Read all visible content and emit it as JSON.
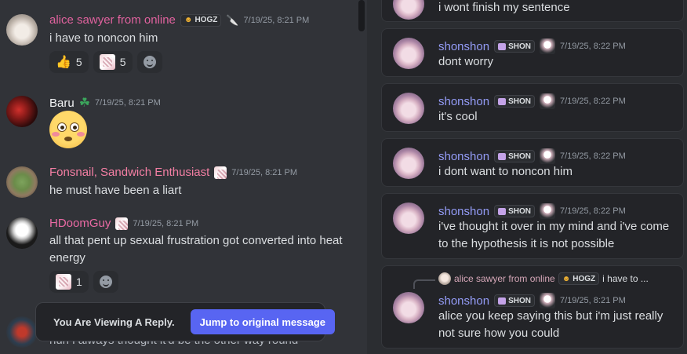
{
  "left_messages": [
    {
      "author": "alice sawyer from online",
      "tag": "HOGZ",
      "timestamp": "7/19/25, 8:21 PM",
      "text": "i have to noncon him",
      "reactions": [
        {
          "emoji": "thumbs-up",
          "glyph": "👍",
          "count": "5"
        },
        {
          "emoji": "sticker-image",
          "count": "5"
        }
      ]
    },
    {
      "author": "Baru",
      "timestamp": "7/19/25, 8:21 PM",
      "emoji": "flushed-face"
    },
    {
      "author": "Fonsnail, Sandwich Enthusiast",
      "timestamp": "7/19/25, 8:21 PM",
      "text": "he must have been a liart"
    },
    {
      "author": "HDoomGuy",
      "timestamp": "7/19/25, 8:21 PM",
      "text": "all that pent up sexual frustration got converted into heat energy",
      "reactions": [
        {
          "emoji": "sticker-image",
          "count": "1"
        }
      ]
    },
    {
      "text": "huh i always thought it'd be the other way round"
    }
  ],
  "banner": {
    "text": "You Are Viewing A Reply.",
    "button": "Jump to original message"
  },
  "right_messages": [
    {
      "text": "i wont finish my sentence"
    },
    {
      "author": "shonshon",
      "tag": "SHON",
      "timestamp": "7/19/25, 8:22 PM",
      "text": "dont worry"
    },
    {
      "author": "shonshon",
      "tag": "SHON",
      "timestamp": "7/19/25, 8:22 PM",
      "text": "it's cool"
    },
    {
      "author": "shonshon",
      "tag": "SHON",
      "timestamp": "7/19/25, 8:22 PM",
      "text": "i dont want to noncon him"
    },
    {
      "author": "shonshon",
      "tag": "SHON",
      "timestamp": "7/19/25, 8:22 PM",
      "text": "i've thought it over in my mind and i've come to the hypothesis it is not possible"
    },
    {
      "reply": {
        "author": "alice sawyer from online",
        "tag": "HOGZ",
        "text": "i have to ..."
      },
      "author": "shonshon",
      "tag": "SHON",
      "timestamp": "7/19/25, 8:21 PM",
      "text": "alice you keep saying this but i'm just really not sure how you could"
    }
  ],
  "colors": {
    "alice_name": "#e0629e",
    "baru_name": "#f2f3f5",
    "fons_name": "#f47fa4",
    "hdoom_name": "#ea6aa4",
    "shon_name": "#949cf7",
    "accent": "#5865f2"
  }
}
